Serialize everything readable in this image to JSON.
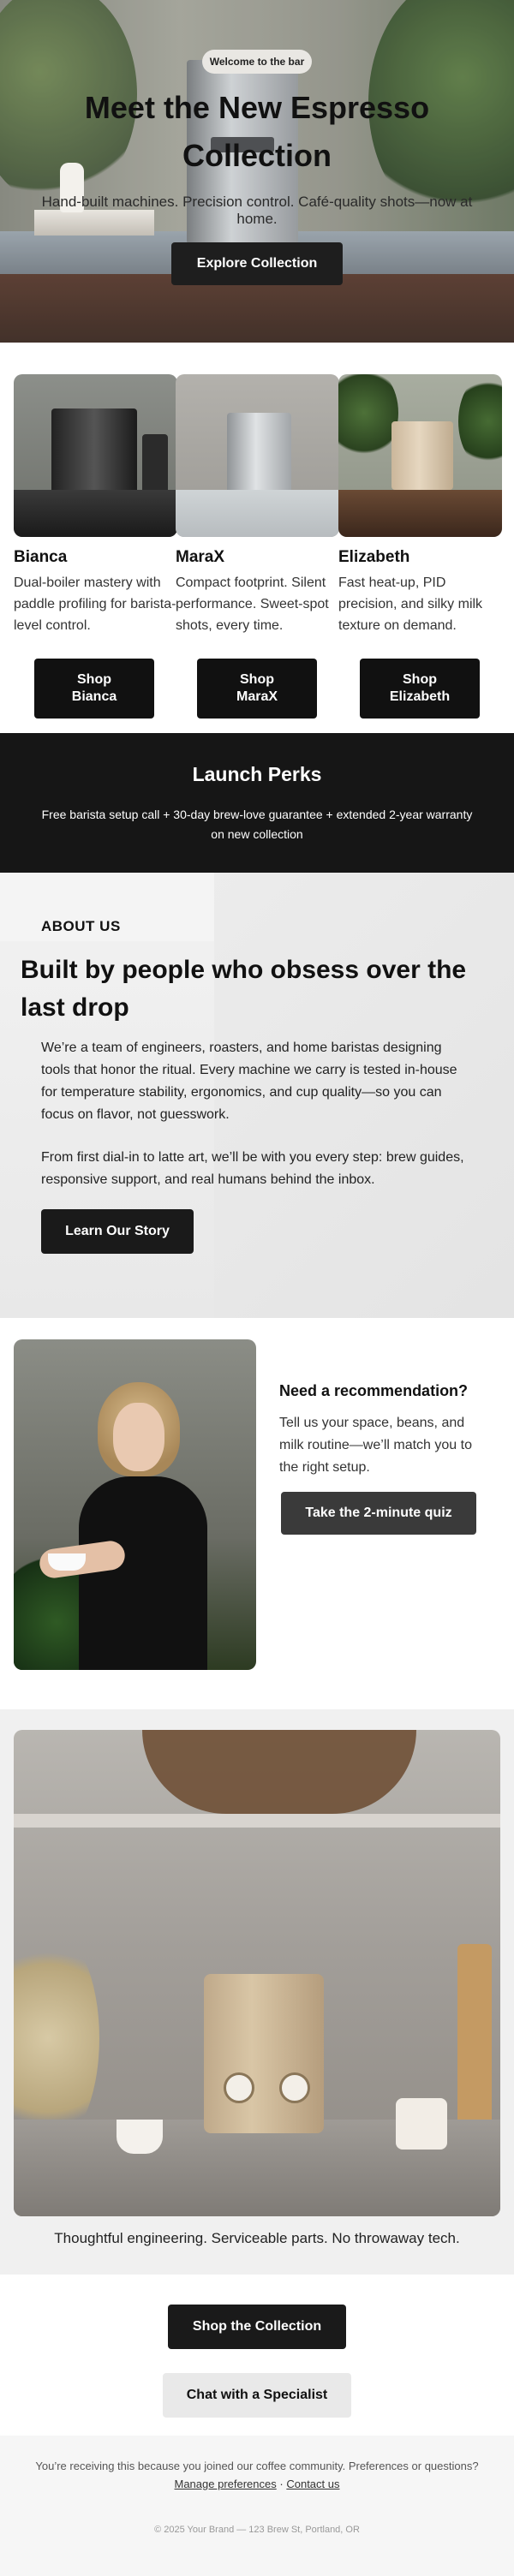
{
  "hero": {
    "badge": "Welcome to the bar",
    "title": "Meet the New Espresso Collection",
    "subtitle": "Hand-built machines. Precision control. Café-quality shots—now at home.",
    "cta": "Explore Collection"
  },
  "products": [
    {
      "name": "Bianca",
      "description": "Dual-boiler mastery with paddle profiling for barista-level control.",
      "button": "Shop Bianca"
    },
    {
      "name": "MaraX",
      "description": "Compact footprint. Silent performance. Sweet-spot shots, every time.",
      "button": "Shop MaraX"
    },
    {
      "name": "Elizabeth",
      "description": "Fast heat-up, PID precision, and silky milk texture on demand.",
      "button": "Shop Elizabeth"
    }
  ],
  "perks": {
    "title": "Launch Perks",
    "text": "Free barista setup call + 30-day brew-love guarantee + extended 2-year warranty on new collection"
  },
  "about": {
    "label": "ABOUT US",
    "headline": "Built by people who obsess over the last drop",
    "paragraph1": "We’re a team of engineers, roasters, and home baristas designing tools that honor the ritual. Every machine we carry is tested in-house for temperature stability, ergonomics, and cup quality—so you can focus on flavor, not guesswork.",
    "paragraph2": "From first dial-in to latte art, we’ll be with you every step: brew guides, responsive support, and real humans behind the inbox.",
    "button": "Learn Our Story"
  },
  "recommendation": {
    "title": "Need a recommendation?",
    "text": "Tell us your space, beans, and milk routine—we’ll match you to the right setup.",
    "button": "Take the 2-minute quiz"
  },
  "feature": {
    "caption": "Thoughtful engineering. Serviceable parts. No throwaway tech."
  },
  "cta": {
    "primary": "Shop the Collection",
    "secondary": "Chat with a Specialist"
  },
  "footer": {
    "notice": "You’re receiving this because you joined our coffee community. Preferences or questions?",
    "link_preferences": "Manage preferences",
    "separator": "·",
    "link_contact": "Contact us",
    "copyright": "© 2025 Your Brand — 123 Brew St, Portland, OR"
  },
  "colors": {
    "dark": "#111111",
    "perks_bg": "#161616",
    "secondary_button": "#e9e9e9",
    "footer_bg": "#f6f6f6"
  }
}
